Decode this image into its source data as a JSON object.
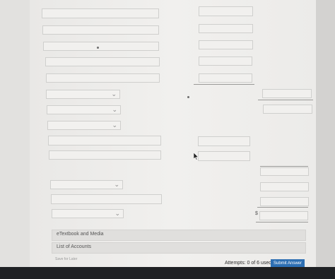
{
  "panels": {
    "etextbook": "eTextbook and Media",
    "accounts": "List of Accounts"
  },
  "footer": {
    "save_later": "Save for Later",
    "attempts": "Attempts: 0 of 6 used",
    "submit": "Submit Answer"
  },
  "currency_symbol": "$"
}
